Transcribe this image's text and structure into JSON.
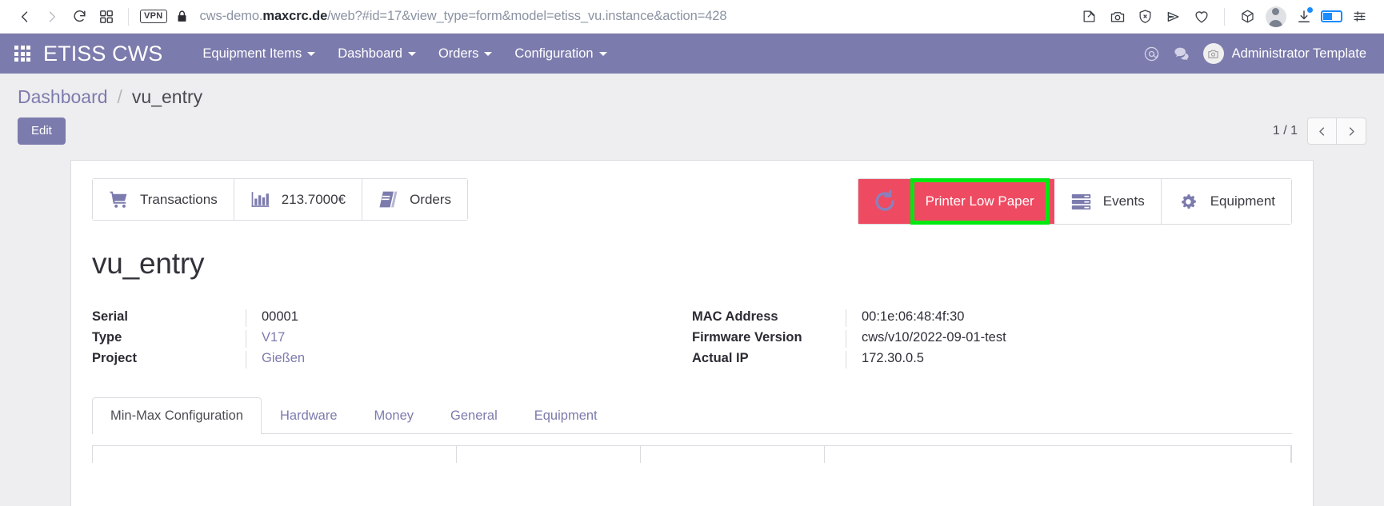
{
  "browser": {
    "nav": {
      "back_icon": "chevron-left-icon",
      "forward_icon": "chevron-right-icon",
      "reload_icon": "reload-icon",
      "tabs_icon": "tab-grid-icon"
    },
    "vpn_badge": "VPN",
    "lock_icon": "lock-icon",
    "url_prefix": "cws-demo.",
    "url_domain": "maxcrc.de",
    "url_path": "/web?#id=17&view_type=form&model=etiss_vu.instance&action=428",
    "url_full": "cws-demo.maxcrc.de/web?#id=17&view_type=form&model=etiss_vu.instance&action=428",
    "toolbar_icons": [
      "collections-pin-icon",
      "screenshot-camera-icon",
      "shield-block-icon",
      "send-share-icon",
      "favorites-heart-icon",
      "cube-3d-icon",
      "profile-avatar-icon",
      "downloads-icon",
      "battery-split-icon",
      "settings-sliders-icon"
    ]
  },
  "navbar": {
    "apps_icon": "apps-grid-icon",
    "brand": "ETISS CWS",
    "menu": [
      {
        "label": "Equipment Items",
        "has_caret": true
      },
      {
        "label": "Dashboard",
        "has_caret": true
      },
      {
        "label": "Orders",
        "has_caret": true
      },
      {
        "label": "Configuration",
        "has_caret": true
      }
    ],
    "mentions_icon": "at-mention-icon",
    "messages_icon": "chat-bubble-icon",
    "user_avatar_icon": "user-avatar-icon",
    "user_name": "Administrator Template"
  },
  "control_panel": {
    "breadcrumb": {
      "parent": "Dashboard",
      "separator": "/",
      "current": "vu_entry"
    },
    "edit_label": "Edit",
    "pager": {
      "count": "1 / 1",
      "prev_icon": "chevron-left-icon",
      "next_icon": "chevron-right-icon"
    }
  },
  "sheet": {
    "stat_buttons_left": [
      {
        "icon": "shopping-cart-icon",
        "label": "Transactions"
      },
      {
        "icon": "bar-chart-icon",
        "label": "213.7000€"
      },
      {
        "icon": "book-orders-icon",
        "label": "Orders"
      }
    ],
    "stat_buttons_right": [
      {
        "icon": "refresh-icon",
        "label": "Printer Low Paper",
        "highlighted": true
      },
      {
        "icon": "events-list-icon",
        "label": "Events",
        "highlighted": false
      },
      {
        "icon": "gears-equipment-icon",
        "label": "Equipment",
        "highlighted": false
      }
    ],
    "record_title": "vu_entry",
    "fields_left": [
      {
        "label": "Serial",
        "value": "00001",
        "is_link": false
      },
      {
        "label": "Type",
        "value": "V17",
        "is_link": true
      },
      {
        "label": "Project",
        "value": "Gießen",
        "is_link": true
      }
    ],
    "fields_right": [
      {
        "label": "MAC Address",
        "value": "00:1e:06:48:4f:30",
        "is_link": false
      },
      {
        "label": "Firmware Version",
        "value": "cws/v10/2022-09-01-test",
        "is_link": false
      },
      {
        "label": "Actual IP",
        "value": "172.30.0.5",
        "is_link": false
      }
    ],
    "tabs": [
      {
        "label": "Min-Max Configuration",
        "active": true
      },
      {
        "label": "Hardware",
        "active": false
      },
      {
        "label": "Money",
        "active": false
      },
      {
        "label": "General",
        "active": false
      },
      {
        "label": "Equipment",
        "active": false
      }
    ]
  },
  "colors": {
    "brand_purple": "#7C7BAD",
    "alert_red": "#EE4B62",
    "highlight_green": "#00E810",
    "panel_grey": "#EEEDEF",
    "accent_blue": "#1A8CFF"
  }
}
